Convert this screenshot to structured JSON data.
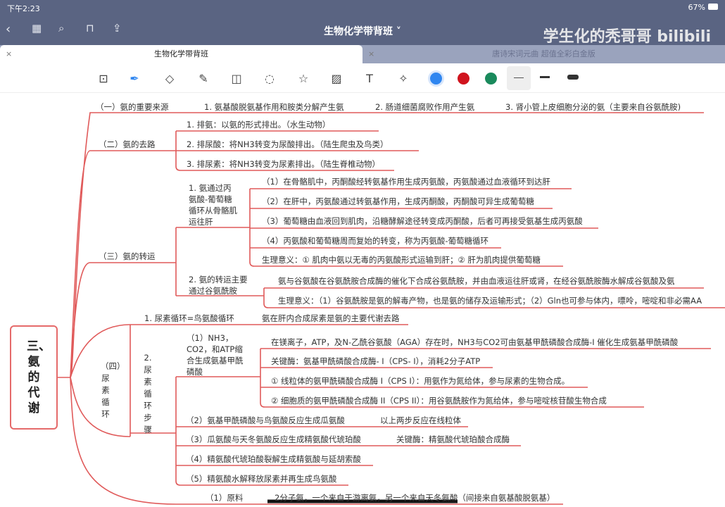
{
  "status": {
    "time": "下午2:23",
    "battery": "67%"
  },
  "nav": {
    "title": "生物化学带背班",
    "watermark": "学生化的秃哥哥 bilibili"
  },
  "tabs": [
    {
      "label": "生物化学带背班",
      "active": true
    },
    {
      "label": "唐诗宋词元曲 超值全彩白金版",
      "active": false
    }
  ],
  "toolbar": {
    "tools": [
      "zoom-lasso",
      "pen",
      "eraser",
      "highlighter",
      "shapes",
      "lasso",
      "sticker",
      "image",
      "text",
      "laser-pointer"
    ],
    "colors": [
      "#2f86f0",
      "#d0141e",
      "#1a8a5c"
    ],
    "accent": "#e05a5a"
  },
  "map": {
    "root": "三、氨的代谢",
    "b1": {
      "label": "（一）氨的重要来源",
      "items": [
        "1. 氨基酸脱氨基作用和胺类分解产生氨",
        "2. 肠道细菌腐败作用产生氨",
        "3. 肾小管上皮细胞分泌的氨（主要来自谷氨酰胺)"
      ]
    },
    "b2": {
      "label": "（二）氨的去路",
      "items": [
        "1. 排氨：以氨的形式排出。（水生动物）",
        "2. 排尿酸：将NH3转变为尿酸排出。（陆生爬虫及鸟类）",
        "3. 排尿素：将NH3转变为尿素排出。（陆生脊椎动物）"
      ]
    },
    "b3": {
      "label": "（三）氨的转运",
      "s1": {
        "label": "1. 氨通过丙氨酸-葡萄糖循环从骨骼肌运往肝",
        "items": [
          "（1）在骨骼肌中，丙酮酸经转氨基作用生成丙氨酸，丙氨酸通过血液循环到达肝",
          "（2）在肝中，丙氨酸通过转氨基作用，生成丙酮酸，丙酮酸可异生成葡萄糖",
          "（3）葡萄糖由血液回到肌肉，沿糖酵解途径转变成丙酮酸，后者可再接受氨基生成丙氨酸",
          "（4）丙氨酸和葡萄糖周而复始的转变，称为丙氨酸-葡萄糖循环",
          "生理意义：① 肌肉中氨以无毒的丙氨酸形式运输到肝；② 肝为肌肉提供葡萄糖"
        ]
      },
      "s2": {
        "label": "2. 氨的转运主要通过谷氨酰胺",
        "items": [
          "氨与谷氨酸在谷氨酰胺合成酶的催化下合成谷氨酰胺，并由血液运往肝或肾，在经谷氨酰胺酶水解成谷氨酸及氨",
          "生理意义：（1）谷氨酰胺是氨的解毒产物，也是氨的储存及运输形式；（2）Gln也可参与体内，嘌呤，嘧啶和非必需AA"
        ]
      }
    },
    "b4": {
      "label": "（四）尿素循环",
      "s1": {
        "label": "1. 尿素循环=鸟氨酸循环",
        "note": "氨在肝内合成尿素是氨的主要代谢去路"
      },
      "s2": {
        "label": "2. 尿素循环步骤",
        "step1": {
          "label": "（1）NH3，CO2，和ATP缩合生成氨基甲酰磷酸",
          "items": [
            "在镁离子，ATP，及N-乙酰谷氨酸（AGA）存在时，NH3与CO2可由氨基甲酰磷酸合成酶-I 催化生成氨基甲酰磷酸",
            "关键酶：氨基甲酰磷酸合成酶- I（CPS- I），消耗2分子ATP",
            "① 线粒体的氨甲酰磷酸合成酶 I（CPS I）：用氨作为氮给体，参与尿素的生物合成。",
            "② 细胞质的氨甲酰磷酸合成酶 II（CPS II）：用谷氨酰胺作为氮给体，参与嘧啶核苷酸生物合成"
          ]
        },
        "step2": {
          "label": "（2）氨基甲酰磷酸与鸟氨酸反应生成瓜氨酸",
          "note": "以上两步反应在线粒体"
        },
        "step3": {
          "label": "（3）瓜氨酸与天冬氨酸反应生成精氨酸代琥珀酸",
          "note": "关键酶：精氨酸代琥珀酸合成酶"
        },
        "step4": {
          "label": "（4）精氨酸代琥珀酸裂解生成精氨酸与延胡索酸"
        },
        "step5": {
          "label": "（5）精氨酸水解释放尿素并再生成鸟氨酸"
        }
      },
      "s3": {
        "label": "（1）原料",
        "note": "2分子氨，一个来自于游离氨，另一个来自天冬氨酸（间接来自氨基酸脱氨基）"
      }
    }
  }
}
